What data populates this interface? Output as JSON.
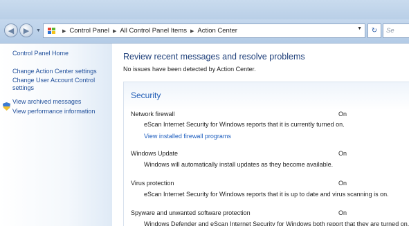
{
  "address_bar": {
    "crumbs": [
      "Control Panel",
      "All Control Panel Items",
      "Action Center"
    ],
    "search_placeholder": "Se"
  },
  "left_nav": {
    "home": "Control Panel Home",
    "items": [
      "Change Action Center settings",
      "Change User Account Control",
      "settings",
      "View archived messages",
      "View performance information"
    ]
  },
  "main": {
    "title": "Review recent messages and resolve problems",
    "subtitle": "No issues have been detected by Action Center.",
    "security": {
      "heading": "Security",
      "rows": [
        {
          "name": "Network firewall",
          "status": "On",
          "description": "eScan Internet Security for Windows reports that it is currently turned on.",
          "link": "View installed firewall programs"
        },
        {
          "name": "Windows Update",
          "status": "On",
          "description": "Windows will automatically install updates as they become available."
        },
        {
          "name": "Virus protection",
          "status": "On",
          "description": "eScan Internet Security for Windows reports that it is up to date and virus scanning is on."
        },
        {
          "name": "Spyware and unwanted software protection",
          "status": "On",
          "description": "Windows Defender and eScan Internet Security for Windows both report that they are turned on."
        }
      ]
    }
  },
  "colors": {
    "link": "#1f4e9a",
    "heading": "#1e3f7a",
    "security_heading": "#1e5bb5"
  },
  "icons": [
    "back-icon",
    "forward-icon",
    "control-panel-flag-icon",
    "refresh-icon",
    "shield-icon"
  ]
}
